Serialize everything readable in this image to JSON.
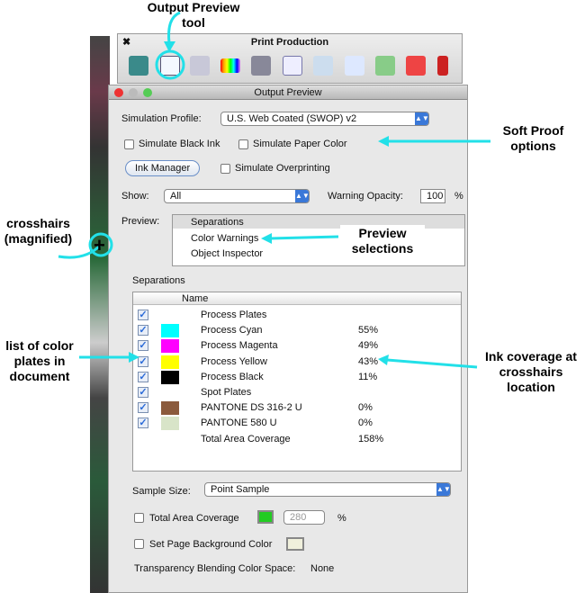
{
  "annotations": {
    "output_preview_tool": "Output Preview tool",
    "soft_proof": "Soft Proof options",
    "crosshairs": "crosshairs (magnified)",
    "preview_selections": "Preview selections",
    "plates_list": "list of color plates in document",
    "ink_coverage": "Ink coverage at crosshairs location"
  },
  "print_production": {
    "title": "Print Production",
    "close": "✖",
    "tools": [
      "convert-colors",
      "output-preview",
      "preflight",
      "ink-manager",
      "trap-presets",
      "add-printer-marks",
      "crop-pages",
      "fix-hairlines",
      "transparency-flattener",
      "pdf-optimizer",
      "edit-object"
    ]
  },
  "window": {
    "title": "Output Preview",
    "simulation_profile_label": "Simulation Profile:",
    "simulation_profile": "U.S. Web Coated (SWOP) v2",
    "simulate_black_ink": "Simulate Black Ink",
    "simulate_paper_color": "Simulate Paper Color",
    "ink_manager": "Ink Manager",
    "simulate_overprinting": "Simulate Overprinting",
    "show_label": "Show:",
    "show_value": "All",
    "warning_opacity_label": "Warning Opacity:",
    "warning_opacity": "100",
    "percent": "%",
    "preview_label": "Preview:",
    "preview_options": [
      "Separations",
      "Color Warnings",
      "Object Inspector"
    ],
    "separations_label": "Separations",
    "column_name": "Name",
    "rows": [
      {
        "name": "Process Plates",
        "color": null,
        "pct": ""
      },
      {
        "name": "Process Cyan",
        "color": "#00ffff",
        "pct": "55%"
      },
      {
        "name": "Process Magenta",
        "color": "#ff00ff",
        "pct": "49%"
      },
      {
        "name": "Process Yellow",
        "color": "#ffff00",
        "pct": "43%"
      },
      {
        "name": "Process Black",
        "color": "#000000",
        "pct": "11%"
      },
      {
        "name": "Spot Plates",
        "color": null,
        "pct": ""
      },
      {
        "name": "PANTONE DS 316-2 U",
        "color": "#8b5a3c",
        "pct": "0%"
      },
      {
        "name": "PANTONE 580 U",
        "color": "#d8e4c8",
        "pct": "0%"
      },
      {
        "name": "Total Area Coverage",
        "color": null,
        "pct": "158%",
        "nocheck": true
      }
    ],
    "sample_size_label": "Sample Size:",
    "sample_size": "Point Sample",
    "total_area_coverage": "Total Area Coverage",
    "tac_value": "280",
    "tac_color": "#22cc22",
    "set_page_bg": "Set Page Background Color",
    "blend_label": "Transparency Blending Color Space:",
    "blend_value": "None"
  },
  "accent": "#22e0e8"
}
